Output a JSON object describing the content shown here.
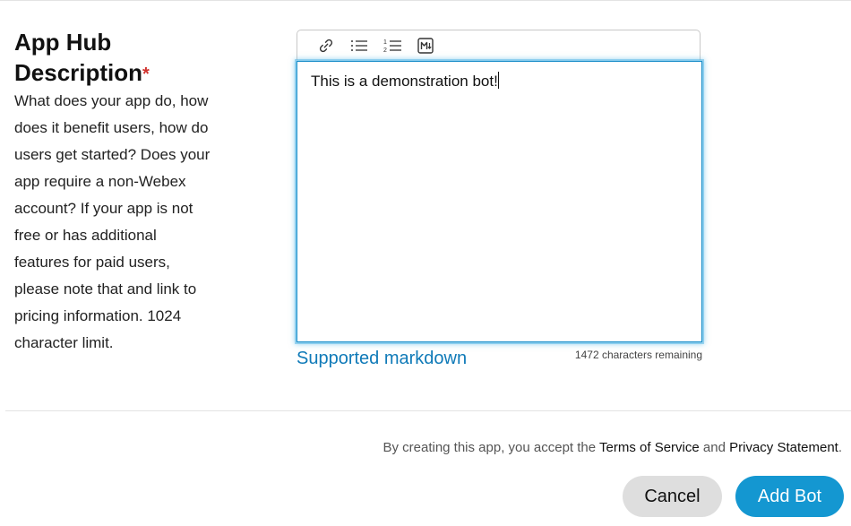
{
  "field": {
    "title_line1": "App Hub",
    "title_line2": "Description",
    "required_marker": "*",
    "help_text": "What does your app do, how does it benefit users, how do users get started? Does your app require a non-Webex account? If your app is not free or has additional features for paid users, please note that and link to pricing information. 1024 character limit."
  },
  "editor": {
    "toolbar": [
      {
        "icon": "link-icon"
      },
      {
        "icon": "bullet-list-icon"
      },
      {
        "icon": "numbered-list-icon"
      },
      {
        "icon": "markdown-icon"
      }
    ],
    "value": "This is a demonstration bot!",
    "markdown_link": "Supported markdown",
    "chars_remaining": "1472 characters remaining"
  },
  "footer": {
    "terms_prefix": "By creating this app, you accept the",
    "terms_link": "Terms of Service",
    "terms_and": "and",
    "privacy_link": "Privacy Statement",
    "terms_suffix": ".",
    "cancel_label": "Cancel",
    "add_label": "Add Bot"
  },
  "colors": {
    "accent": "#1497d1",
    "link": "#0f7ab8",
    "required": "#d0312d",
    "focus_ring": "#46b0e2"
  }
}
